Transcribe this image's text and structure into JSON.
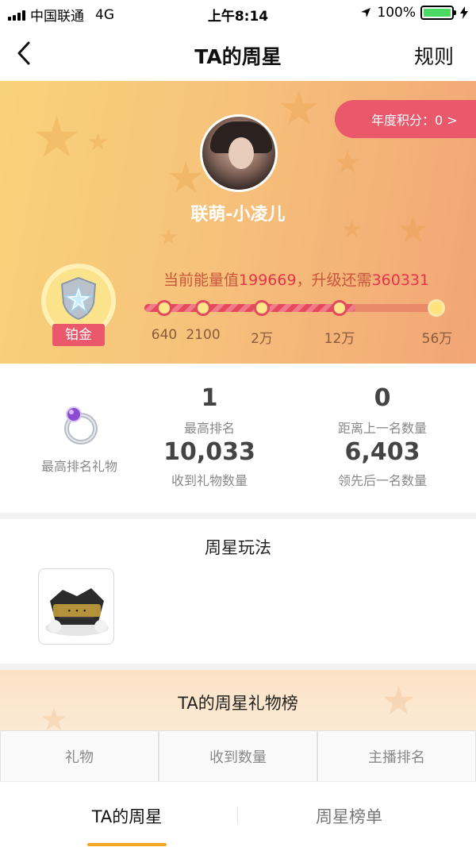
{
  "status_bar": {
    "carrier": "中国联通",
    "network": "4G",
    "time": "上午8:14",
    "battery": "100%",
    "icons": [
      "signal-icon",
      "location-arrow-icon",
      "battery-icon",
      "charging-bolt-icon"
    ]
  },
  "nav": {
    "back_icon": "chevron-left-icon",
    "title": "TA的周星",
    "rules": "规则"
  },
  "hero": {
    "annual_score": "年度积分：0 >",
    "username": "联萌-小凌儿",
    "level": "铂金",
    "energy": {
      "prefix": "当前能量值",
      "value": "199669",
      "middle": "，升级还需",
      "needed": "360331"
    },
    "progress": {
      "milestones": [
        "640",
        "2100",
        "2万",
        "12万",
        "56万"
      ],
      "fill_fraction": 0.72
    },
    "colors": {
      "accent_red": "#e9586b",
      "gold": "#fbe38b"
    }
  },
  "stats": {
    "gift_label": "最高排名礼物",
    "gift_icon": "amethyst-ring-icon",
    "items": [
      {
        "value": "1",
        "label": "最高排名"
      },
      {
        "value": "0",
        "label": "距离上一名数量"
      },
      {
        "value": "10,033",
        "label": "收到礼物数量"
      },
      {
        "value": "6,403",
        "label": "领先后一名数量"
      }
    ]
  },
  "gameplay": {
    "heading": "周星玩法",
    "game_tile_icon": "game-logo-icon"
  },
  "gift_ranking": {
    "heading": "TA的周星礼物榜",
    "columns": [
      "礼物",
      "收到数量",
      "主播排名"
    ]
  },
  "tabs": [
    {
      "label": "TA的周星",
      "active": true
    },
    {
      "label": "周星榜单",
      "active": false
    }
  ]
}
